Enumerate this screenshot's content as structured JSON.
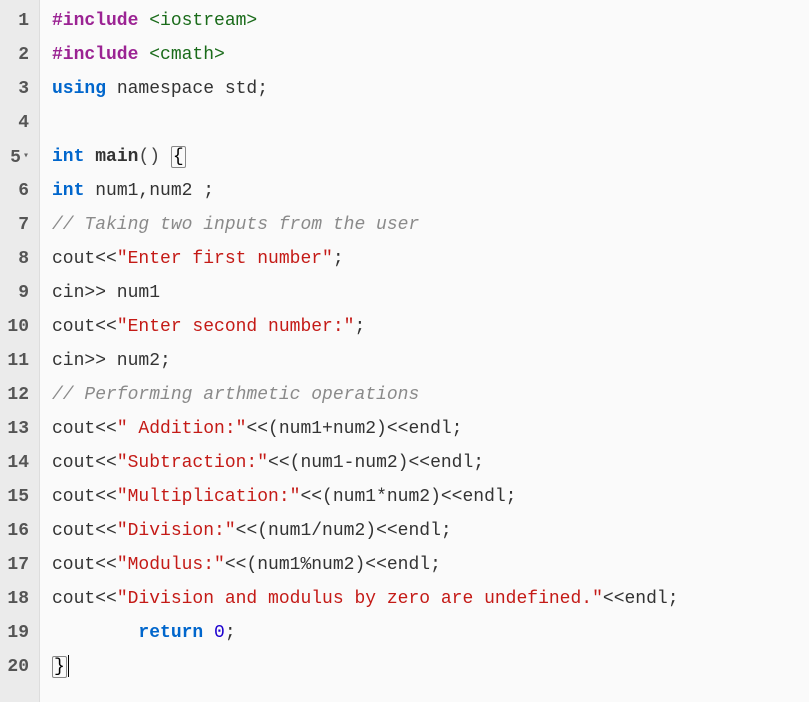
{
  "lines": [
    {
      "num": "1",
      "fold": false,
      "tokens": [
        {
          "cls": "kw-preproc",
          "t": "#include "
        },
        {
          "cls": "kw-include",
          "t": "<iostream>"
        }
      ]
    },
    {
      "num": "2",
      "fold": false,
      "tokens": [
        {
          "cls": "kw-preproc",
          "t": "#include "
        },
        {
          "cls": "kw-include",
          "t": "<cmath>"
        }
      ]
    },
    {
      "num": "3",
      "fold": false,
      "tokens": [
        {
          "cls": "kw-using",
          "t": "using "
        },
        {
          "cls": "kw-ident",
          "t": "namespace std;"
        }
      ]
    },
    {
      "num": "4",
      "fold": false,
      "tokens": []
    },
    {
      "num": "5",
      "fold": true,
      "tokens": [
        {
          "cls": "kw-type",
          "t": "int "
        },
        {
          "cls": "kw-func",
          "t": "main"
        },
        {
          "cls": "kw-op",
          "t": "() "
        },
        {
          "cls": "brace-highlight",
          "t": "{"
        }
      ]
    },
    {
      "num": "6",
      "fold": false,
      "tokens": [
        {
          "cls": "kw-type",
          "t": "int "
        },
        {
          "cls": "kw-ident",
          "t": "num1,num2 ;"
        }
      ]
    },
    {
      "num": "7",
      "fold": false,
      "tokens": [
        {
          "cls": "kw-comment",
          "t": "// Taking two inputs from the user"
        }
      ]
    },
    {
      "num": "8",
      "fold": false,
      "tokens": [
        {
          "cls": "kw-ident",
          "t": "cout<<"
        },
        {
          "cls": "kw-string",
          "t": "\"Enter first number\""
        },
        {
          "cls": "kw-ident",
          "t": ";"
        }
      ]
    },
    {
      "num": "9",
      "fold": false,
      "tokens": [
        {
          "cls": "kw-ident",
          "t": "cin>> num1"
        }
      ]
    },
    {
      "num": "10",
      "fold": false,
      "tokens": [
        {
          "cls": "kw-ident",
          "t": "cout<<"
        },
        {
          "cls": "kw-string",
          "t": "\"Enter second number:\""
        },
        {
          "cls": "kw-ident",
          "t": ";"
        }
      ]
    },
    {
      "num": "11",
      "fold": false,
      "tokens": [
        {
          "cls": "kw-ident",
          "t": "cin>> num2;"
        }
      ]
    },
    {
      "num": "12",
      "fold": false,
      "tokens": [
        {
          "cls": "kw-comment",
          "t": "// Performing arthmetic operations"
        }
      ]
    },
    {
      "num": "13",
      "fold": false,
      "tokens": [
        {
          "cls": "kw-ident",
          "t": "cout<<"
        },
        {
          "cls": "kw-string",
          "t": "\" Addition:\""
        },
        {
          "cls": "kw-ident",
          "t": "<<(num1+num2)<<endl;"
        }
      ]
    },
    {
      "num": "14",
      "fold": false,
      "tokens": [
        {
          "cls": "kw-ident",
          "t": "cout<<"
        },
        {
          "cls": "kw-string",
          "t": "\"Subtraction:\""
        },
        {
          "cls": "kw-ident",
          "t": "<<(num1-num2)<<endl;"
        }
      ]
    },
    {
      "num": "15",
      "fold": false,
      "tokens": [
        {
          "cls": "kw-ident",
          "t": "cout<<"
        },
        {
          "cls": "kw-string",
          "t": "\"Multiplication:\""
        },
        {
          "cls": "kw-ident",
          "t": "<<(num1*num2)<<endl;"
        }
      ]
    },
    {
      "num": "16",
      "fold": false,
      "tokens": [
        {
          "cls": "kw-ident",
          "t": "cout<<"
        },
        {
          "cls": "kw-string",
          "t": "\"Division:\""
        },
        {
          "cls": "kw-ident",
          "t": "<<(num1/num2)<<endl;"
        }
      ]
    },
    {
      "num": "17",
      "fold": false,
      "tokens": [
        {
          "cls": "kw-ident",
          "t": "cout<<"
        },
        {
          "cls": "kw-string",
          "t": "\"Modulus:\""
        },
        {
          "cls": "kw-ident",
          "t": "<<(num1%num2)<<endl;"
        }
      ]
    },
    {
      "num": "18",
      "fold": false,
      "tokens": [
        {
          "cls": "kw-ident",
          "t": "cout<<"
        },
        {
          "cls": "kw-string",
          "t": "\"Division and modulus by zero are undefined.\""
        },
        {
          "cls": "kw-ident",
          "t": "<<endl;"
        }
      ]
    },
    {
      "num": "19",
      "fold": false,
      "indent": "        ",
      "tokens": [
        {
          "cls": "kw-return",
          "t": "return "
        },
        {
          "cls": "kw-num",
          "t": "0"
        },
        {
          "cls": "kw-ident",
          "t": ";"
        }
      ]
    },
    {
      "num": "20",
      "fold": false,
      "tokens": [
        {
          "cls": "brace-highlight",
          "t": "}"
        },
        {
          "cls": "cursor",
          "t": ""
        }
      ]
    }
  ]
}
